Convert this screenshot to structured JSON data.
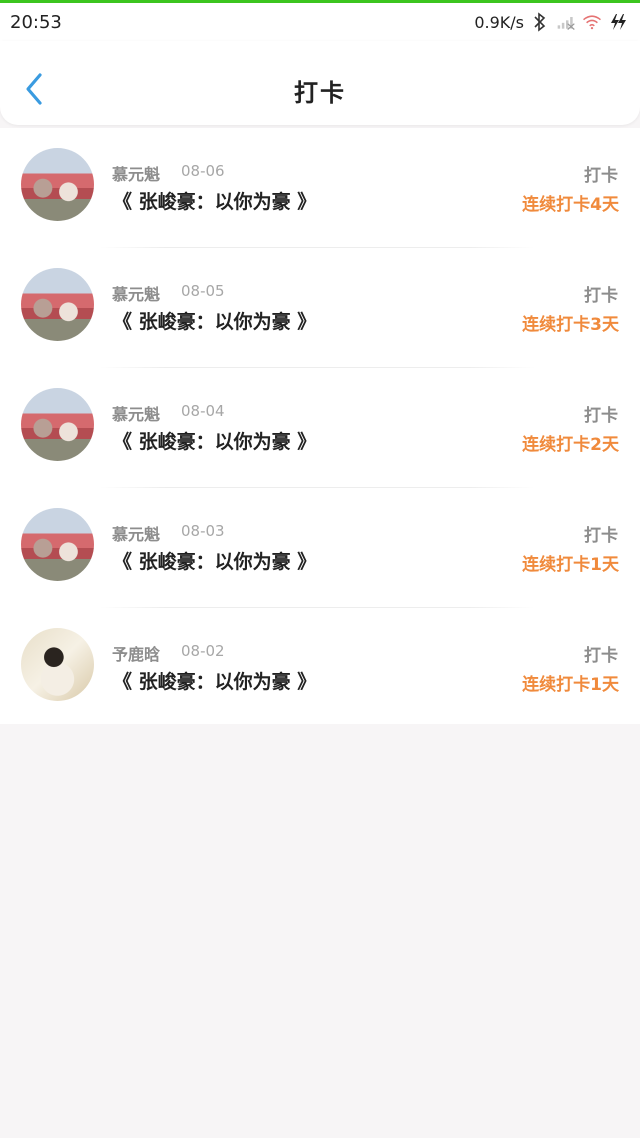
{
  "status_bar": {
    "time": "20:53",
    "net_speed": "0.9K/s",
    "icons": [
      "bluetooth-icon",
      "signal-icon",
      "wifi-icon",
      "charging-icon"
    ],
    "progress_color": "#3cc51f"
  },
  "header": {
    "back_icon": "chevron-left-icon",
    "title": "打卡",
    "accent_color": "#3a9be0"
  },
  "checkins": [
    {
      "name": "慕元魁",
      "date": "08-06",
      "book": "《 张峻豪：以你为豪 》",
      "action": "打卡",
      "streak": "连续打卡4天",
      "avatar": "avatar-couple"
    },
    {
      "name": "慕元魁",
      "date": "08-05",
      "book": "《 张峻豪：以你为豪 》",
      "action": "打卡",
      "streak": "连续打卡3天",
      "avatar": "avatar-couple"
    },
    {
      "name": "慕元魁",
      "date": "08-04",
      "book": "《 张峻豪：以你为豪 》",
      "action": "打卡",
      "streak": "连续打卡2天",
      "avatar": "avatar-couple"
    },
    {
      "name": "慕元魁",
      "date": "08-03",
      "book": "《 张峻豪：以你为豪 》",
      "action": "打卡",
      "streak": "连续打卡1天",
      "avatar": "avatar-couple"
    },
    {
      "name": "予鹿晗",
      "date": "08-02",
      "book": "《 张峻豪：以你为豪 》",
      "action": "打卡",
      "streak": "连续打卡1天",
      "avatar": "avatar-person"
    }
  ],
  "colors": {
    "streak": "#f08a3c",
    "muted_text": "#8d8d8d",
    "background": "#f7f5f6"
  }
}
